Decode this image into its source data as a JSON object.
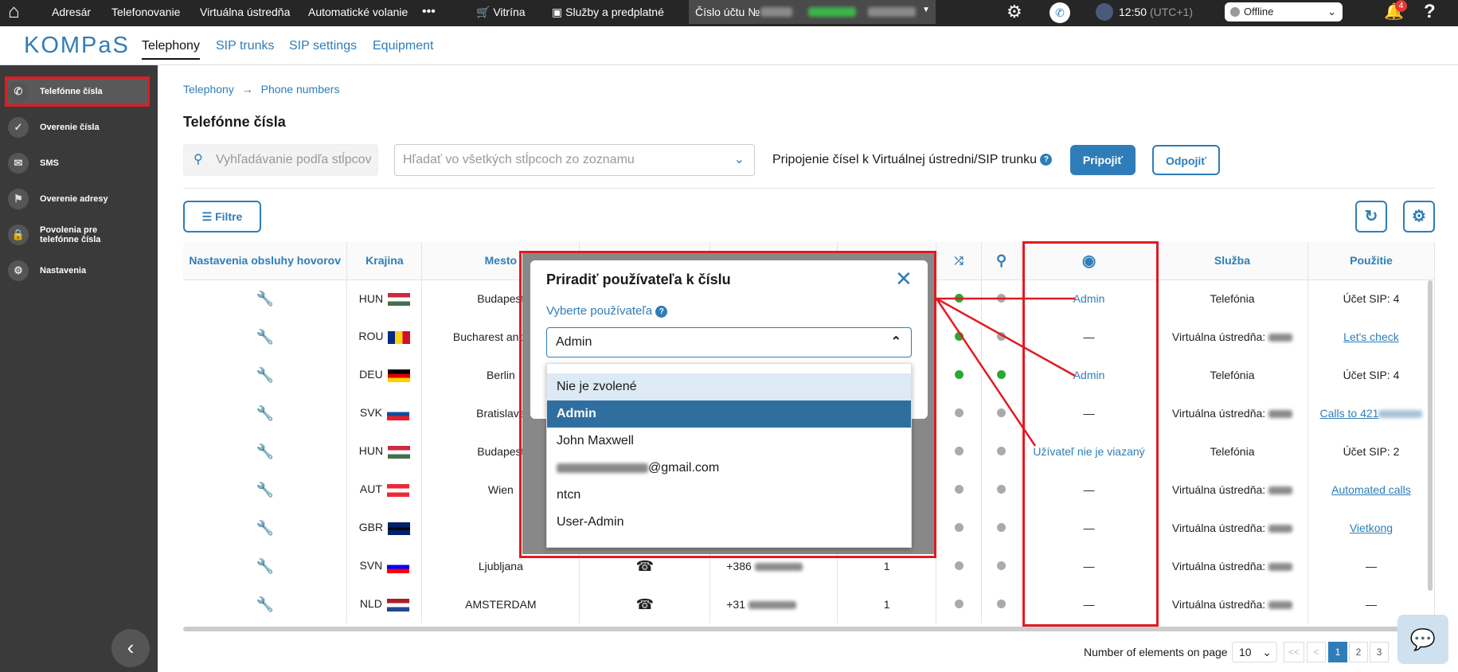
{
  "topbar": {
    "items": [
      "Adresár",
      "Telefonovanie",
      "Virtuálna ústredňa",
      "Automatické volanie"
    ],
    "more": "•••",
    "shop": "Vitrína",
    "services": "Služby a predplatné",
    "account_label": "Číslo účtu №",
    "time": "12:50",
    "tz": "(UTC+1)",
    "status": "Offline",
    "notif_count": "4",
    "help": "?"
  },
  "header": {
    "logo": "KOMPaS",
    "tabs": [
      "Telephony",
      "SIP trunks",
      "SIP settings",
      "Equipment"
    ]
  },
  "sidebar": {
    "items": [
      "Telefónne čísla",
      "Overenie čísla",
      "SMS",
      "Overenie adresy",
      "Povolenia pre telefónne čísla",
      "Nastavenia"
    ]
  },
  "breadcrumb": {
    "root": "Telephony",
    "sep": "→",
    "current": "Phone numbers"
  },
  "page_title": "Telefónne čísla",
  "toolbar": {
    "search_placeholder": "Vyhľadávanie podľa stĺpcov",
    "column_search_placeholder": "Hľadať vo všetkých stĺpcoch zo zoznamu",
    "connect_text": "Pripojenie čísel k Virtuálnej ústredni/SIP trunku",
    "connect_btn": "Pripojiť",
    "disconnect_btn": "Odpojiť",
    "filters_btn": "Filtre"
  },
  "table": {
    "headers": {
      "settings": "Nastavenia obsluhy hovorov",
      "country": "Krajina",
      "city": "Mesto",
      "service": "Služba",
      "usage": "Použitie"
    },
    "rows": [
      {
        "country": "HUN",
        "city": "Budapest",
        "number": "",
        "limit": "",
        "user": "Admin",
        "service": "Telefónia",
        "usage": "Účet SIP: 4"
      },
      {
        "country": "ROU",
        "city": "Bucharest and Ilfov",
        "number": "",
        "limit": "",
        "user": "—",
        "service": "Virtuálna ústredňa:",
        "usage": "Let's check"
      },
      {
        "country": "DEU",
        "city": "Berlin",
        "number": "",
        "limit": "",
        "user": "Admin",
        "service": "Telefónia",
        "usage": "Účet SIP: 4"
      },
      {
        "country": "SVK",
        "city": "Bratislava",
        "number": "",
        "limit": "",
        "user": "—",
        "service": "Virtuálna ústredňa:",
        "usage": "Calls to 421"
      },
      {
        "country": "HUN",
        "city": "Budapest",
        "number": "",
        "limit": "",
        "user": "Užívateľ nie je viazaný",
        "service": "Telefónia",
        "usage": "Účet SIP: 2"
      },
      {
        "country": "AUT",
        "city": "Wien",
        "number": "",
        "limit": "",
        "user": "—",
        "service": "Virtuálna ústredňa:",
        "usage": "Automated calls"
      },
      {
        "country": "GBR",
        "city": "",
        "number": "",
        "limit": "",
        "user": "—",
        "service": "Virtuálna ústredňa:",
        "usage": "Vietkong"
      },
      {
        "country": "SVN",
        "city": "Ljubljana",
        "number": "+386",
        "limit": "1",
        "user": "—",
        "service": "Virtuálna ústredňa:",
        "usage": "—"
      },
      {
        "country": "NLD",
        "city": "AMSTERDAM",
        "number": "+31",
        "limit": "1",
        "user": "—",
        "service": "Virtuálna ústredňa:",
        "usage": "—"
      }
    ]
  },
  "modal": {
    "title": "Priradiť používateľa k číslu",
    "label": "Vyberte používateľa",
    "selected": "Admin",
    "options": [
      "Nie je zvolené",
      "Admin",
      "John Maxwell",
      "@gmail.com",
      "ntcn",
      "User-Admin"
    ]
  },
  "pagination": {
    "label": "Number of elements on page",
    "size": "10",
    "first": "<<",
    "prev": "<",
    "pages": [
      "1",
      "2",
      "3"
    ]
  },
  "colors": {
    "accent": "#2f7db8",
    "annotation": "#e01b22",
    "topbar": "#262626",
    "sidebar": "#3a3a3a"
  }
}
